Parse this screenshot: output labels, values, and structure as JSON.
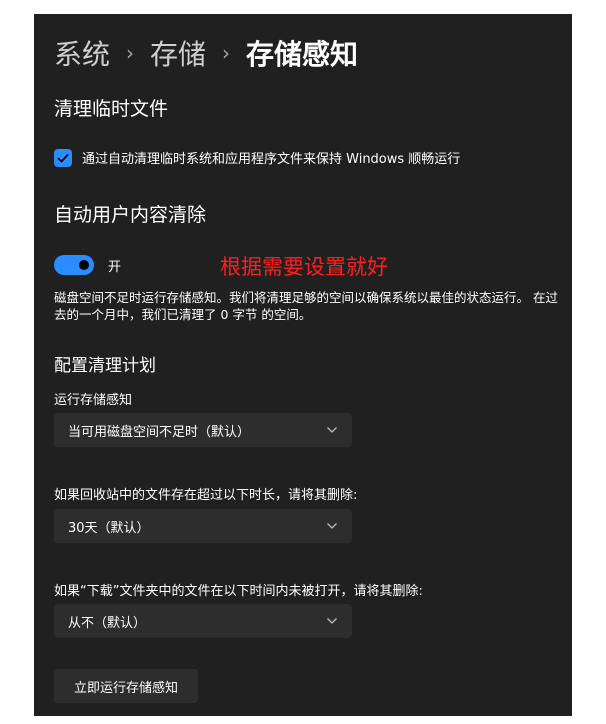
{
  "breadcrumb": {
    "items": [
      "系统",
      "存储"
    ],
    "separator": "›",
    "current": "存储感知"
  },
  "temp_files": {
    "heading": "清理临时文件",
    "checkbox_label": "通过自动清理临时系统和应用程序文件来保持 Windows 顺畅运行",
    "checked": true
  },
  "auto_cleanup": {
    "heading": "自动用户内容清除",
    "toggle_label": "开",
    "toggle_on": true,
    "annotation": "根据需要设置就好",
    "description": "磁盘空间不足时运行存储感知。我们将清理足够的空间以确保系统以最佳的状态运行。 在过去的一个月中，我们已清理了 0 字节 的空间。"
  },
  "schedule": {
    "heading": "配置清理计划",
    "run_label": "运行存储感知",
    "run_value": "当可用磁盘空间不足时（默认）",
    "recycle_label": "如果回收站中的文件存在超过以下时长，请将其删除:",
    "recycle_value": "30天（默认）",
    "downloads_label": "如果“下载”文件夹中的文件在以下时间内未被打开，请将其删除:",
    "downloads_value": "从不（默认）"
  },
  "run_now_button": "立即运行存储感知",
  "colors": {
    "panel_bg": "#202020",
    "accent": "#2b8cff",
    "control_bg": "#2d2d2d",
    "annotation": "#ff1e1e"
  }
}
